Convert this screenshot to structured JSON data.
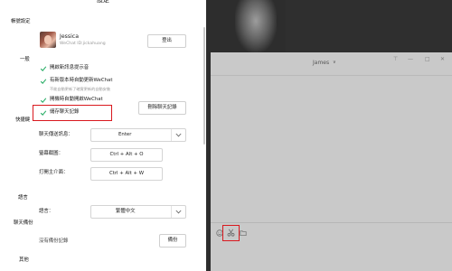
{
  "settings": {
    "title": "設定",
    "account_section": "帳號設定",
    "user": {
      "name": "Jessica",
      "wechat_id": "WeChat ID:jickahuang"
    },
    "logout_label": "登出",
    "general_section": "一般",
    "options": [
      {
        "label": "開啟新訊息提示音",
        "checked": true
      },
      {
        "label": "有新版本時自動更新WeChat",
        "checked": true
      },
      {
        "label": "開機時自動開啟WeChat",
        "checked": true
      },
      {
        "label": "儲存聊天記錄",
        "checked": true
      }
    ],
    "update_hint": "不能自動更新了確實更新的自動安裝",
    "clear_history_label": "刪除聊天記錄",
    "shortcuts_section": "快捷鍵",
    "shortcuts": [
      {
        "label": "聊天傳送訊息：",
        "value": "Enter"
      },
      {
        "label": "螢幕截圖：",
        "value": "Ctrl + Alt + O"
      },
      {
        "label": "打開主介面：",
        "value": "Ctrl + Alt + W"
      }
    ],
    "language_section": "語言",
    "language_label": "語言：",
    "language_value": "繁體中文",
    "backup_section": "聊天備份",
    "no_backup_text": "沒有備份記錄",
    "backup_button": "備份",
    "other_section": "其他"
  },
  "chat": {
    "contact_name": "James",
    "chevron": "∨",
    "pin_icon": "⊤",
    "minimize_icon": "—",
    "maximize_icon": "□",
    "close_icon": "✕"
  },
  "colors": {
    "highlight": "#d9181e",
    "check": "#2aae67",
    "chat_bg": "#c9c9c9"
  },
  "icons": [
    "check-icon",
    "chevron-down-icon",
    "emoji-icon",
    "scissors-icon",
    "folder-icon"
  ]
}
